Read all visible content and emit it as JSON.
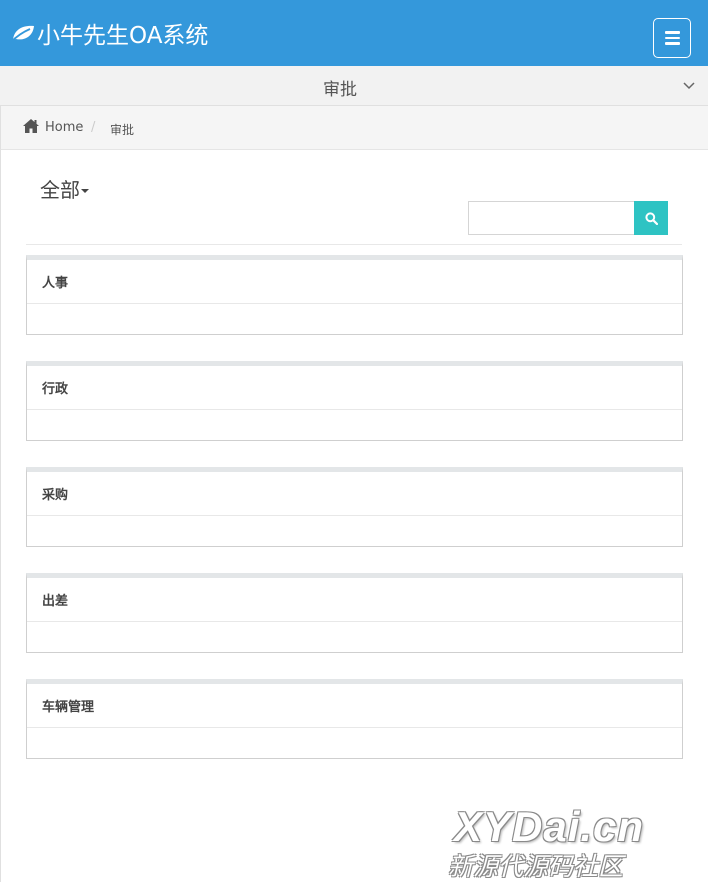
{
  "header": {
    "title": "小牛先生OA系统",
    "logo_icon": "leaf-icon",
    "menu_icon": "hamburger-menu-icon",
    "brand_color": "#3498db"
  },
  "subheader": {
    "title": "审批",
    "chevron_icon": "chevron-down-icon"
  },
  "breadcrumb": {
    "home_icon": "home-icon",
    "home_label": "Home",
    "separator": "/",
    "current": "审批"
  },
  "filter": {
    "label": "全部"
  },
  "search": {
    "placeholder": "",
    "value": "",
    "button_icon": "search-icon",
    "button_color": "#2ec3c3"
  },
  "categories": [
    {
      "title": "人事"
    },
    {
      "title": "行政"
    },
    {
      "title": "采购"
    },
    {
      "title": "出差"
    },
    {
      "title": "车辆管理"
    }
  ],
  "watermark": {
    "text": "XYDai.cn",
    "subtext": "新源代源码社区"
  }
}
